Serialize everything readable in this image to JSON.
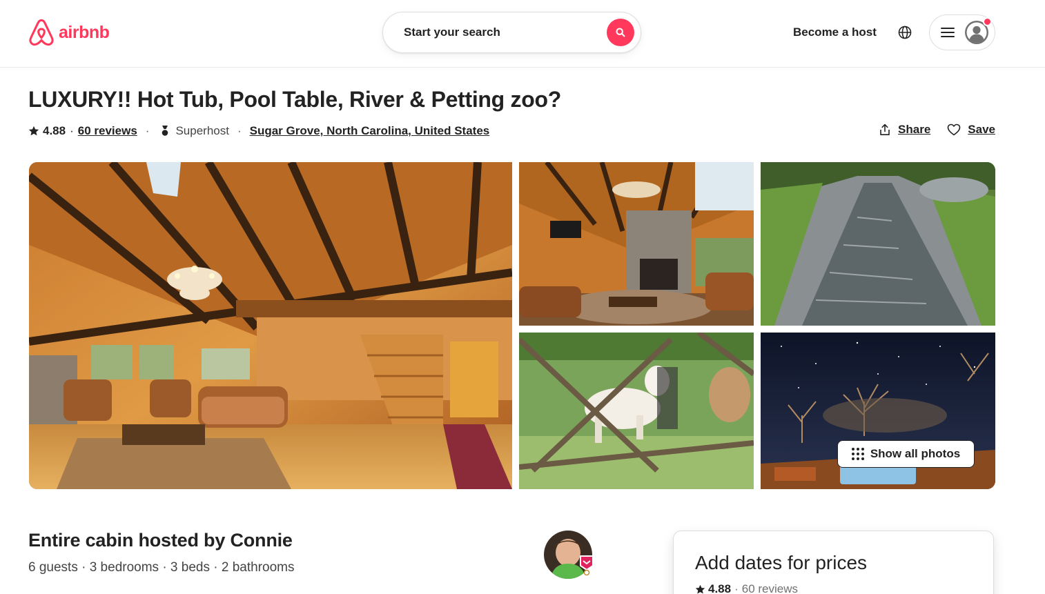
{
  "brand": {
    "name": "airbnb",
    "color": "#ff385c"
  },
  "header": {
    "search_label": "Start your search",
    "become_host": "Become a host",
    "icons": [
      "search-icon",
      "globe-icon",
      "menu-icon",
      "user-icon"
    ]
  },
  "listing": {
    "title": "LUXURY!! Hot Tub, Pool Table, River & Petting zoo?",
    "rating": "4.88",
    "reviews_link": "60 reviews",
    "superhost": "Superhost",
    "location": "Sugar Grove, North Carolina, United States",
    "share": "Share",
    "save": "Save"
  },
  "gallery": {
    "show_all": "Show all photos",
    "photos": [
      "cabin-interior-living-room",
      "cabin-great-room-fireplace",
      "river-creek",
      "goat-pen",
      "hot-tub-night-sky"
    ]
  },
  "summary": {
    "heading": "Entire cabin hosted by Connie",
    "details": "6 guests · 3 bedrooms · 3 beds · 2 bathrooms"
  },
  "booking": {
    "title": "Add dates for prices",
    "rating": "4.88",
    "sep": "·",
    "reviews": "60 reviews"
  }
}
